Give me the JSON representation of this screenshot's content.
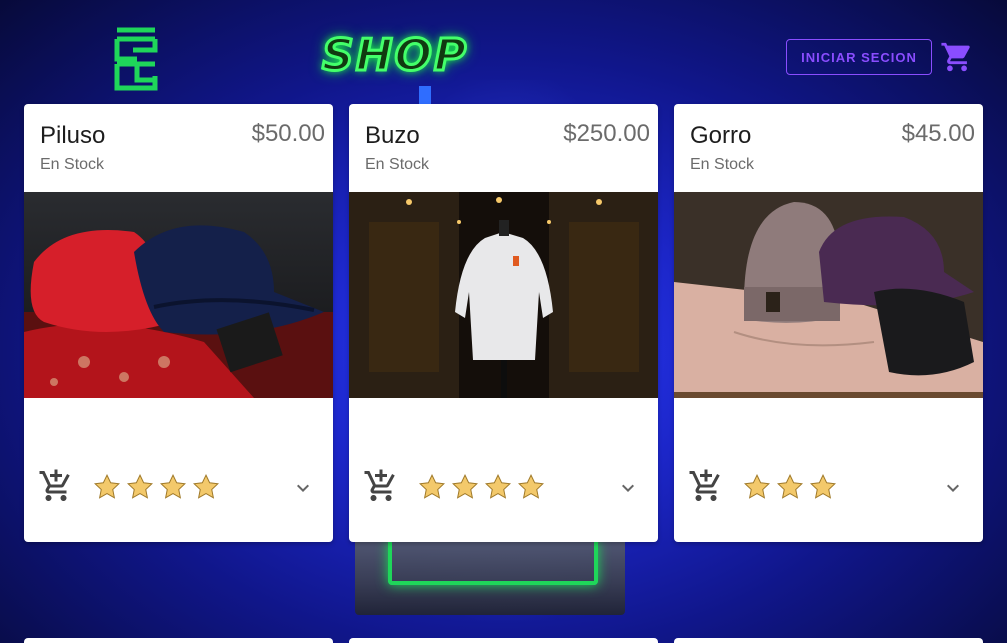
{
  "header": {
    "logo_icon": "brand-logo-icon",
    "shop_title": "SHOP",
    "login_label": "INICIAR SECION",
    "cart_icon": "shopping-cart-icon"
  },
  "colors": {
    "accent_purple": "#8a4dff",
    "neon_green": "#43ff6a",
    "star_fill": "#f3c96b",
    "background": "#1c26c8"
  },
  "products": [
    {
      "title": "Piluso",
      "status": "En Stock",
      "price": "$50.00",
      "rating": 4,
      "image": "bucket-hats-photo"
    },
    {
      "title": "Buzo",
      "status": "En Stock",
      "price": "$250.00",
      "rating": 4,
      "image": "hoodie-photo"
    },
    {
      "title": "Gorro",
      "status": "En Stock",
      "price": "$45.00",
      "rating": 3,
      "image": "beanie-photo"
    }
  ]
}
